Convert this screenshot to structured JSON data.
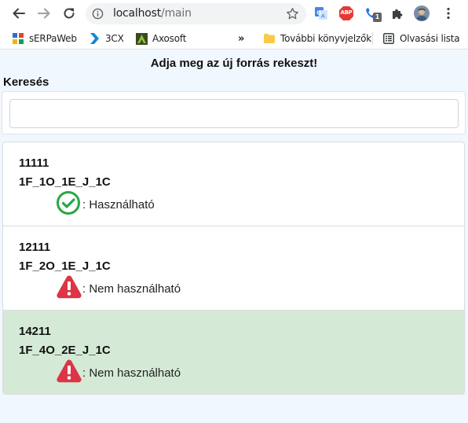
{
  "browser": {
    "url_host": "localhost",
    "url_path": "/main",
    "extension_badge": "1",
    "abp_label": "ABP",
    "bookmarks": [
      {
        "label": "sERPaWeb"
      },
      {
        "label": "3CX"
      },
      {
        "label": "Axosoft"
      }
    ],
    "more_label": "»",
    "other_bookmarks": "További könyvjelzők",
    "reading_list": "Olvasási lista"
  },
  "page": {
    "title": "Adja meg az új forrás rekeszt!",
    "search_label": "Keresés",
    "search_value": "",
    "search_placeholder": ""
  },
  "items": [
    {
      "id": "11111",
      "code": "1F_1O_1E_J_1C",
      "status": "ok",
      "status_text": ": Használható",
      "selected": false
    },
    {
      "id": "12111",
      "code": "1F_2O_1E_J_1C",
      "status": "error",
      "status_text": ": Nem használható",
      "selected": false
    },
    {
      "id": "14211",
      "code": "1F_4O_2E_J_1C",
      "status": "error",
      "status_text": ": Nem használható",
      "selected": true
    }
  ],
  "colors": {
    "ok": "#28a745",
    "error": "#dc3545",
    "selected_row": "#d4ead6",
    "page_background": "#f0f7ff"
  }
}
